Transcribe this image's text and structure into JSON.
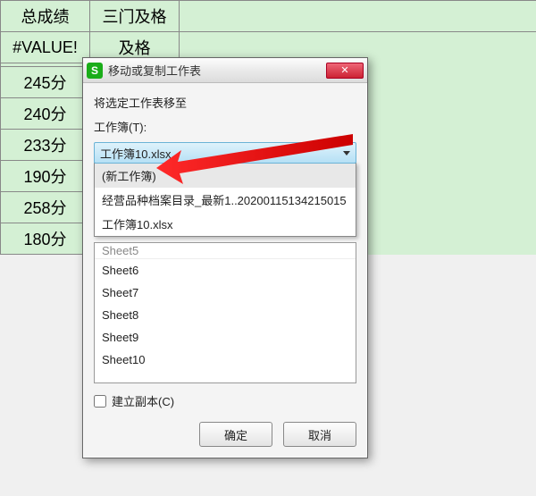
{
  "sheet": {
    "headers": [
      "总成绩",
      "三门及格"
    ],
    "rows": [
      [
        "#VALUE!",
        "及格"
      ],
      [
        "245分",
        ""
      ],
      [
        "240分",
        ""
      ],
      [
        "233分",
        ""
      ],
      [
        "190分",
        ""
      ],
      [
        "258分",
        ""
      ],
      [
        "180分",
        ""
      ]
    ]
  },
  "dialog": {
    "title": "移动或复制工作表",
    "label_move_to": "将选定工作表移至",
    "label_workbook": "工作簿(T):",
    "selected_workbook": "工作簿10.xlsx",
    "dropdown_options": [
      "(新工作簿)",
      "经营品种档案目录_最新1..20200115134215015",
      "工作簿10.xlsx"
    ],
    "sheet_list": [
      "Sheet5",
      "Sheet6",
      "Sheet7",
      "Sheet8",
      "Sheet9",
      "Sheet10"
    ],
    "checkbox_label": "建立副本(C)",
    "ok": "确定",
    "cancel": "取消"
  },
  "icons": {
    "app_letter": "S",
    "close_glyph": "✕"
  }
}
